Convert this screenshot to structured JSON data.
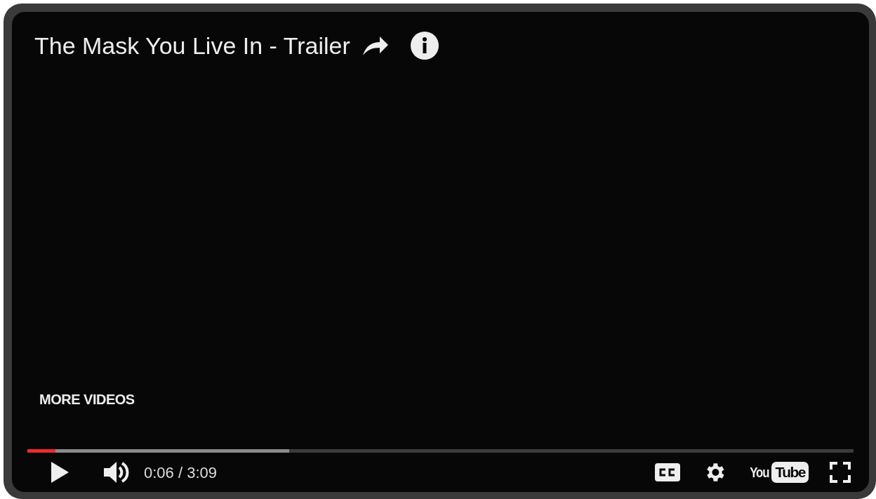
{
  "player": {
    "title": "The Mask You Live In - Trailer",
    "more_videos": "MORE VIDEOS",
    "progress": {
      "level": 0.034,
      "buffer": {
        "level": 0.317
      }
    },
    "playing": false,
    "time": "0:06 / 3:09",
    "logo": [
      "You",
      "Tube"
    ]
  }
}
